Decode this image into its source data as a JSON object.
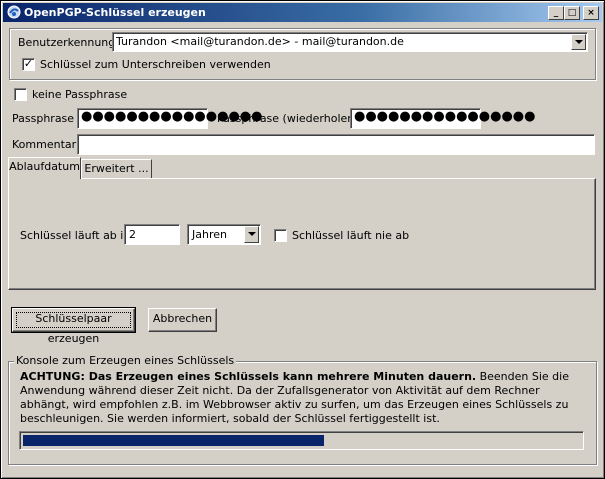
{
  "window": {
    "title": "OpenPGP-Schlüssel erzeugen",
    "minimize": "_",
    "maximize": "□",
    "close": "×"
  },
  "user": {
    "label": "Benutzerkennung",
    "value": "Turandon <mail@turandon.de> - mail@turandon.de"
  },
  "signing": {
    "label": "Schlüssel zum Unterschreiben verwenden",
    "checked": "✓"
  },
  "no_passphrase": {
    "label": "keine Passphrase"
  },
  "passphrase": {
    "label": "Passphrase",
    "value": "●●●●●●●●●●●●●●●●",
    "repeat_label": "Passphrase (wiederholen)",
    "repeat_value": "●●●●●●●●●●●●●●●●"
  },
  "comment": {
    "label": "Kommentar",
    "value": ""
  },
  "tabs": [
    {
      "label": "Ablaufdatum"
    },
    {
      "label": "Erweitert ..."
    }
  ],
  "expiry": {
    "label": "Schlüssel läuft ab in",
    "amount": "2",
    "unit": "Jahren",
    "never_label": "Schlüssel läuft nie ab"
  },
  "actions": {
    "generate": "Schlüsselpaar erzeugen",
    "cancel": "Abbrechen"
  },
  "console": {
    "title": "Konsole zum Erzeugen eines Schlüssels",
    "warning_bold": "ACHTUNG: Das Erzeugen eines Schlüssels kann mehrere Minuten dauern.",
    "warning_text": " Beenden Sie die Anwendung während dieser Zeit nicht. Da der Zufallsgenerator von Aktivität auf dem Rechner abhängt, wird empfohlen z.B. im Webbrowser aktiv zu surfen, um das Erzeugen eines Schlüssels zu beschleunigen. Sie werden informiert, sobald der Schlüssel fertiggestellt ist.",
    "progress": 0.54
  },
  "colors": {
    "titlebar": "#0a246a",
    "face": "#d4d0c8",
    "progress": "#0a246a"
  }
}
